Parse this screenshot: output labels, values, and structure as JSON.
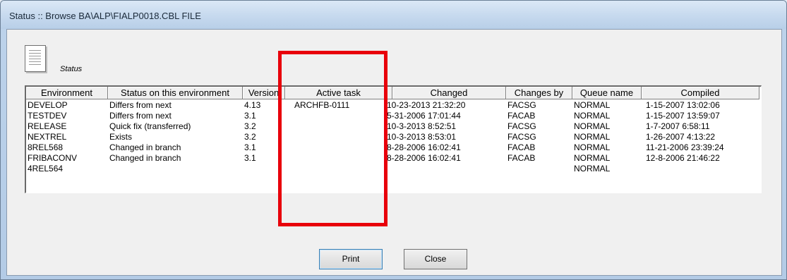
{
  "window": {
    "title": "Status :: Browse BA\\ALP\\FIALP0018.CBL FILE"
  },
  "header_section": {
    "icon": "document-icon",
    "label": "Status"
  },
  "table": {
    "columns": [
      "Environment",
      "Status on this environment",
      "Version",
      "Active task",
      "Changed",
      "Changes by",
      "Queue name",
      "Compiled"
    ],
    "rows": [
      [
        "DEVELOP",
        "Differs from next",
        "4.13",
        "ARCHFB-0111",
        "10-23-2013 21:32:20",
        "FACSG",
        "NORMAL",
        "1-15-2007 13:02:06"
      ],
      [
        "TESTDEV",
        "Differs from next",
        "3.1",
        "",
        "5-31-2006 17:01:44",
        "FACAB",
        "NORMAL",
        "1-15-2007 13:59:07"
      ],
      [
        "RELEASE",
        "Quick fix (transferred)",
        "3.2",
        "",
        "10-3-2013 8:52:51",
        "FACSG",
        "NORMAL",
        "1-7-2007 6:58:11"
      ],
      [
        "NEXTREL",
        "Exists",
        "3.2",
        "",
        "10-3-2013 8:53:01",
        "FACSG",
        "NORMAL",
        "1-26-2007 4:13:22"
      ],
      [
        "8REL568",
        "Changed in branch",
        "3.1",
        "",
        "8-28-2006 16:02:41",
        "FACAB",
        "NORMAL",
        "11-21-2006 23:39:24"
      ],
      [
        "FRIBACONV",
        "Changed in branch",
        "3.1",
        "",
        "8-28-2006 16:02:41",
        "FACAB",
        "NORMAL",
        "12-8-2006 21:46:22"
      ],
      [
        "4REL564",
        "",
        "",
        "",
        "",
        "",
        "NORMAL",
        ""
      ]
    ]
  },
  "buttons": {
    "print": "Print",
    "close": "Close"
  },
  "colors": {
    "highlight": "#e8000b"
  }
}
